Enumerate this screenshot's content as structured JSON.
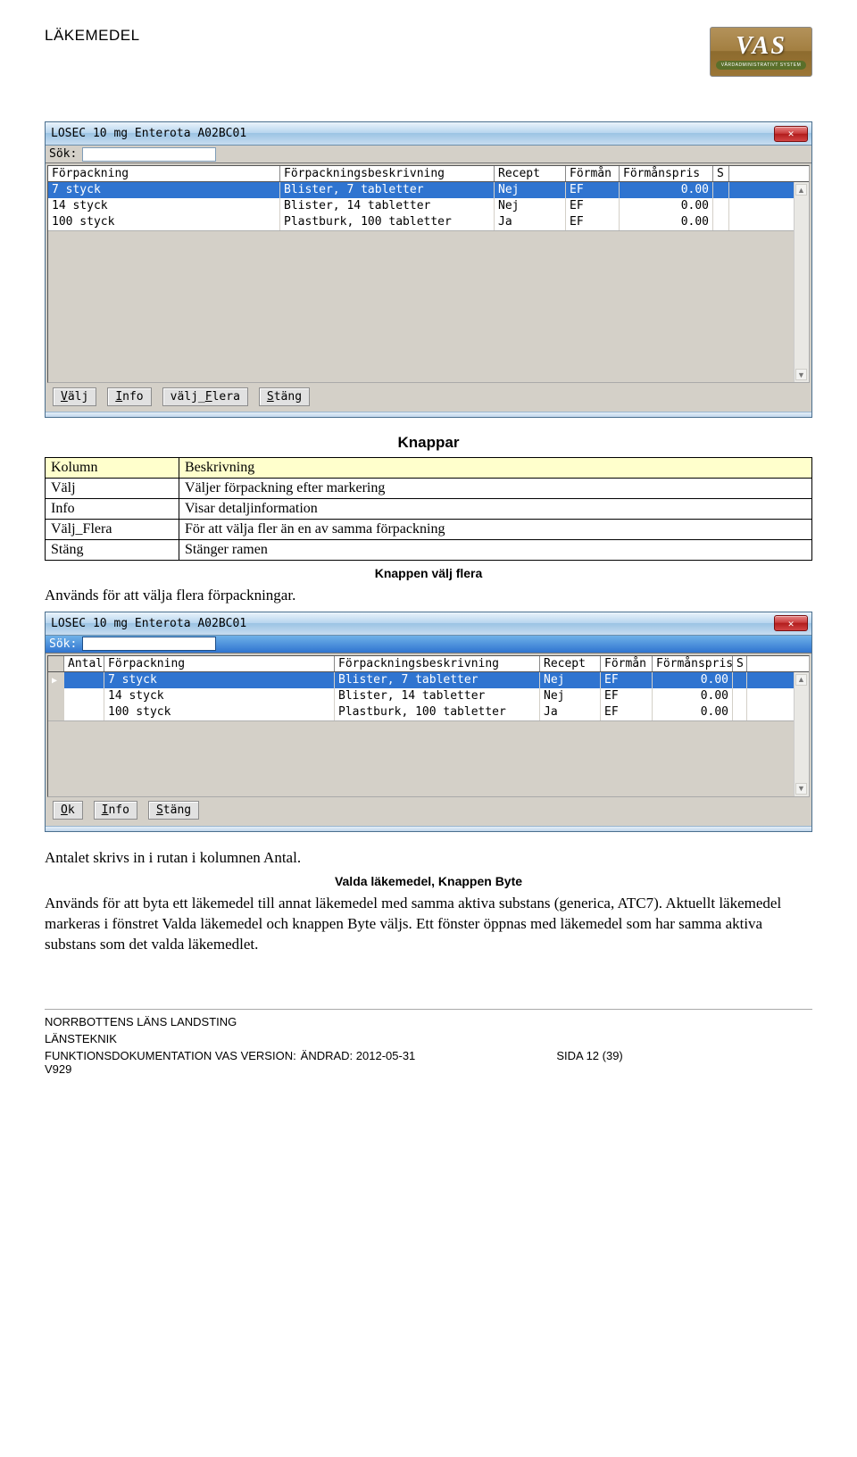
{
  "header": {
    "title": "LÄKEMEDEL"
  },
  "logo": {
    "text": "VAS",
    "tagline": "VÅRDADMINISTRATIVT SYSTEM"
  },
  "window1": {
    "title": "LOSEC  10 mg   Enterota  A02BC01",
    "search_label": "Sök:",
    "columns": [
      "Förpackning",
      "Förpackningsbeskrivning",
      "Recept",
      "Förmån",
      "Förmånspris",
      "S"
    ],
    "rows": [
      {
        "forp": "7 styck",
        "besk": "Blister, 7 tabletter",
        "rec": "Nej",
        "form": "EF",
        "pris": "0.00",
        "s": ""
      },
      {
        "forp": "14 styck",
        "besk": "Blister, 14 tabletter",
        "rec": "Nej",
        "form": "EF",
        "pris": "0.00",
        "s": ""
      },
      {
        "forp": "100 styck",
        "besk": "Plastburk, 100 tabletter",
        "rec": "Ja",
        "form": "EF",
        "pris": "0.00",
        "s": ""
      }
    ],
    "buttons": {
      "valj": "Välj",
      "info": "Info",
      "flera": "välj_Flera",
      "stang": "Stäng"
    }
  },
  "knappar_title": "Knappar",
  "knappar_table": {
    "head": {
      "col": "Kolumn",
      "desc": "Beskrivning"
    },
    "rows": [
      {
        "col": "Välj",
        "desc": "Väljer förpackning efter markering"
      },
      {
        "col": "Info",
        "desc": "Visar detaljinformation"
      },
      {
        "col": "Välj_Flera",
        "desc": "För att välja fler än en av samma förpackning"
      },
      {
        "col": "Stäng",
        "desc": "Stänger ramen"
      }
    ]
  },
  "sub_valj_flera": "Knappen välj flera",
  "para_valj_flera": "Används för att välja flera förpackningar.",
  "window2": {
    "title": "LOSEC   10 mg   Enterota   A02BC01",
    "search_label": "Sök:",
    "columns": [
      "Antal",
      "Förpackning",
      "Förpackningsbeskrivning",
      "Recept",
      "Förmån",
      "Förmånspris",
      "S"
    ],
    "rows": [
      {
        "antal": "",
        "forp": "7 styck",
        "besk": "Blister, 7 tabletter",
        "rec": "Nej",
        "form": "EF",
        "pris": "0.00",
        "s": ""
      },
      {
        "antal": "",
        "forp": "14 styck",
        "besk": "Blister, 14 tabletter",
        "rec": "Nej",
        "form": "EF",
        "pris": "0.00",
        "s": ""
      },
      {
        "antal": "",
        "forp": "100 styck",
        "besk": "Plastburk, 100 tabletter",
        "rec": "Ja",
        "form": "EF",
        "pris": "0.00",
        "s": ""
      }
    ],
    "buttons": {
      "ok": "Ok",
      "info": "Info",
      "stang": "Stäng"
    }
  },
  "para_antal": "Antalet skrivs in i rutan i kolumnen Antal.",
  "sub_byte": "Valda läkemedel, Knappen Byte",
  "para_byte": "Används för att byta ett läkemedel till annat läkemedel med samma aktiva substans (generica, ATC7). Aktuellt läkemedel markeras i fönstret Valda läkemedel och knappen Byte väljs. Ett fönster öppnas med läkemedel som har samma aktiva substans som det valda läkemedlet.",
  "footer": {
    "l1": "NORRBOTTENS LÄNS LANDSTING",
    "l2": "LÄNSTEKNIK",
    "l3a": "FUNKTIONSDOKUMENTATION VAS VERSION: V929",
    "l3b": "ÄNDRAD: 2012-05-31",
    "l3c": "SIDA 12 (39)"
  }
}
